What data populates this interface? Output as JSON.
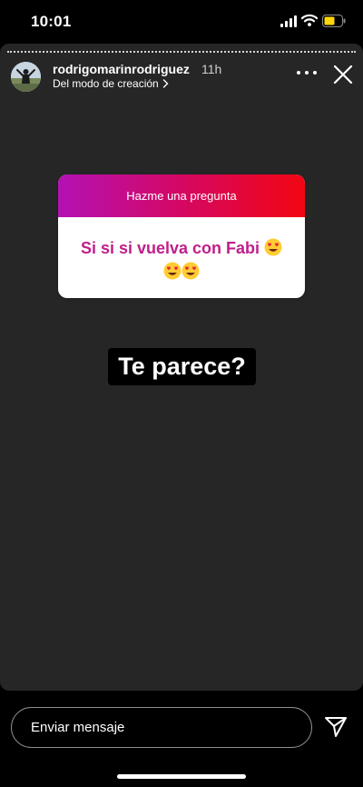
{
  "status_bar": {
    "time": "10:01"
  },
  "story": {
    "username": "rodrigomarinrodriguez",
    "time_ago": "11h",
    "subtitle": "Del modo de creación",
    "icons": {
      "more": "more-icon",
      "close": "close-icon",
      "chevron": "chevron-right-icon"
    }
  },
  "question_sticker": {
    "prompt": "Hazme una pregunta",
    "answer_line1": "Si si si vuelva con Fabi",
    "emoji": "heart-eyes-emoji",
    "gradient": [
      "#b411b4",
      "#d8075a",
      "#f20612"
    ],
    "answer_color": "#bf1f8a"
  },
  "caption": "Te parece?",
  "reply": {
    "placeholder": "Enviar mensaje",
    "send_icon": "send-icon"
  }
}
